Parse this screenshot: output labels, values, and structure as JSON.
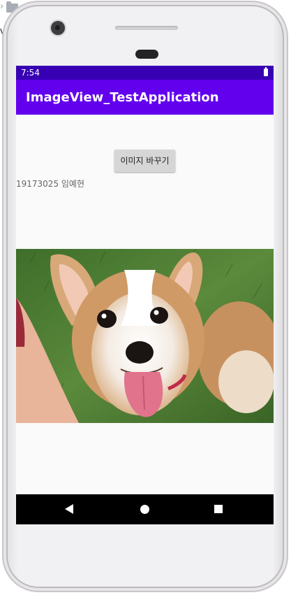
{
  "status_bar": {
    "time": "7:54"
  },
  "app_bar": {
    "title": "ImageView_TestApplication"
  },
  "content": {
    "change_image_button": "이미지 바꾸기",
    "student_label": "19173025 임예현"
  },
  "ide_fragment": {
    "letter": "V"
  },
  "icons": {
    "battery": "battery-icon",
    "back": "back-icon",
    "home": "home-icon",
    "recents": "recents-icon"
  }
}
